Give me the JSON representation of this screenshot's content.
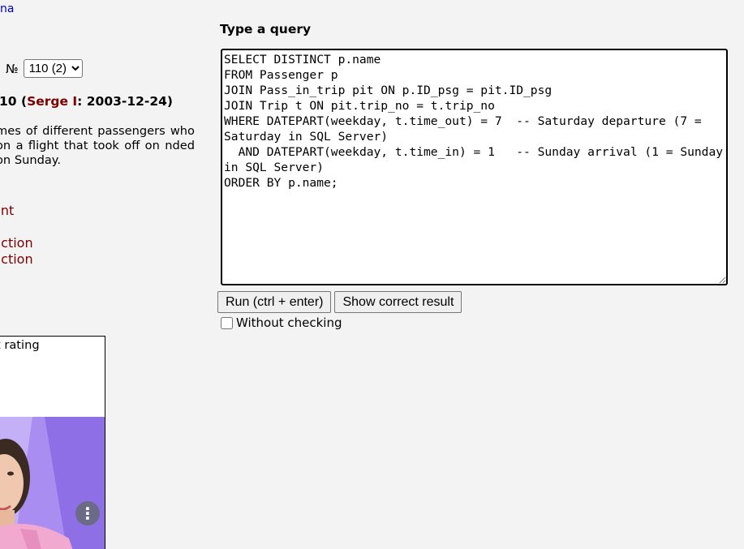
{
  "top_link": "na",
  "exercise": {
    "number_label": "№",
    "selected_option": "110 (2)",
    "header_number": "10",
    "header_author": "Serge I",
    "header_date": ": 2003-12-24",
    "text": "mes of different passengers who on a flight that took off on nded on Sunday."
  },
  "side_links": [
    "ent",
    "nction",
    "nction"
  ],
  "ad": {
    "caption": "t rating",
    "menu_icon": "⋮"
  },
  "query": {
    "title": "Type a query",
    "text": "SELECT DISTINCT p.name\nFROM Passenger p\nJOIN Pass_in_trip pit ON p.ID_psg = pit.ID_psg\nJOIN Trip t ON pit.trip_no = t.trip_no\nWHERE DATEPART(weekday, t.time_out) = 7  -- Saturday departure (7 = Saturday in SQL Server)\n  AND DATEPART(weekday, t.time_in) = 1   -- Sunday arrival (1 = Sunday in SQL Server)\nORDER BY p.name;"
  },
  "buttons": {
    "run_label": "Run (ctrl + enter)",
    "show_result_label": "Show correct result"
  },
  "checkbox": {
    "label": "Without checking",
    "checked": false
  }
}
